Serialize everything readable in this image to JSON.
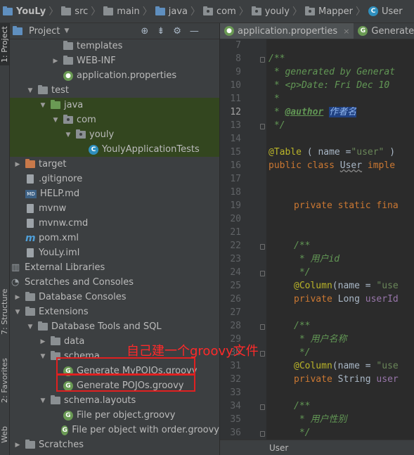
{
  "breadcrumb": [
    "YouLy",
    "src",
    "main",
    "java",
    "com",
    "youly",
    "Mapper",
    "User"
  ],
  "left_strip": {
    "project_tab": "1: Project",
    "structure_tab": "7: Structure",
    "favorites_tab": "2: Favorites",
    "web_tab": "Web"
  },
  "project_panel": {
    "title": "Project",
    "view_dropdown": "Project"
  },
  "tree": [
    {
      "label": "templates",
      "indent": 3,
      "icon": "folder",
      "arrow": "",
      "hl": ""
    },
    {
      "label": "WEB-INF",
      "indent": 3,
      "icon": "folder",
      "arrow": "right",
      "hl": ""
    },
    {
      "label": "application.properties",
      "indent": 3,
      "icon": "properties",
      "arrow": "",
      "hl": ""
    },
    {
      "label": "test",
      "indent": 1,
      "icon": "folder",
      "arrow": "down",
      "hl": ""
    },
    {
      "label": "java",
      "indent": 2,
      "icon": "folder-green",
      "arrow": "down",
      "hl": "green"
    },
    {
      "label": "com",
      "indent": 3,
      "icon": "package",
      "arrow": "down",
      "hl": "green"
    },
    {
      "label": "youly",
      "indent": 4,
      "icon": "package",
      "arrow": "down",
      "hl": "green"
    },
    {
      "label": "YoulyApplicationTests",
      "indent": 5,
      "icon": "class",
      "arrow": "",
      "hl": "green"
    },
    {
      "label": "target",
      "indent": 0,
      "icon": "folder-orange",
      "arrow": "right",
      "hl": ""
    },
    {
      "label": ".gitignore",
      "indent": 0,
      "icon": "file",
      "arrow": "",
      "hl": ""
    },
    {
      "label": "HELP.md",
      "indent": 0,
      "icon": "md",
      "arrow": "",
      "hl": ""
    },
    {
      "label": "mvnw",
      "indent": 0,
      "icon": "file",
      "arrow": "",
      "hl": ""
    },
    {
      "label": "mvnw.cmd",
      "indent": 0,
      "icon": "file",
      "arrow": "",
      "hl": ""
    },
    {
      "label": "pom.xml",
      "indent": 0,
      "icon": "maven",
      "arrow": "",
      "hl": ""
    },
    {
      "label": "YouLy.iml",
      "indent": 0,
      "icon": "file",
      "arrow": "",
      "hl": ""
    },
    {
      "label": "External Libraries",
      "indent": -1,
      "icon": "libs",
      "arrow": "",
      "hl": ""
    },
    {
      "label": "Scratches and Consoles",
      "indent": -1,
      "icon": "scratch",
      "arrow": "",
      "hl": ""
    },
    {
      "label": "Database Consoles",
      "indent": 0,
      "icon": "folder",
      "arrow": "right",
      "hl": ""
    },
    {
      "label": "Extensions",
      "indent": 0,
      "icon": "folder",
      "arrow": "down",
      "hl": ""
    },
    {
      "label": "Database Tools and SQL",
      "indent": 1,
      "icon": "folder",
      "arrow": "down",
      "hl": ""
    },
    {
      "label": "data",
      "indent": 2,
      "icon": "folder",
      "arrow": "right",
      "hl": ""
    },
    {
      "label": "schema",
      "indent": 2,
      "icon": "folder",
      "arrow": "down",
      "hl": ""
    },
    {
      "label": "Generate MyPOJOs.groovy",
      "indent": 3,
      "icon": "groovy",
      "arrow": "",
      "hl": ""
    },
    {
      "label": "Generate POJOs.groovy",
      "indent": 3,
      "icon": "groovy",
      "arrow": "",
      "hl": ""
    },
    {
      "label": "schema.layouts",
      "indent": 2,
      "icon": "folder",
      "arrow": "down",
      "hl": ""
    },
    {
      "label": "File per object.groovy",
      "indent": 3,
      "icon": "groovy",
      "arrow": "",
      "hl": ""
    },
    {
      "label": "File per object with order.groovy",
      "indent": 3,
      "icon": "groovy",
      "arrow": "",
      "hl": ""
    },
    {
      "label": "Scratches",
      "indent": 0,
      "icon": "folder",
      "arrow": "right",
      "hl": ""
    }
  ],
  "annotation_text": "自己建一个groovy文件",
  "editor": {
    "tabs": [
      {
        "label": "application.properties",
        "close": "×"
      },
      {
        "label": "Generate My",
        "close": ""
      }
    ],
    "line_numbers": [
      "7",
      "8",
      "9",
      "10",
      "11",
      "12",
      "13",
      "14",
      "15",
      "16",
      "17",
      "18",
      "19",
      "20",
      "21",
      "22",
      "23",
      "24",
      "25",
      "26",
      "27",
      "28",
      "29",
      "30",
      "31",
      "32",
      "33",
      "34",
      "35",
      "36"
    ],
    "current_line": "12",
    "code": {
      "l8": "/**",
      "l9_prefix": " * ",
      "l9_text": "generated by Generat",
      "l10_prefix": " * ",
      "l10_tag": "<p>",
      "l10_text": "Date: Fri Dec 10",
      "l11": " *",
      "l12_prefix": " * ",
      "l12_tag": "@author",
      "l12_text": "作者名",
      "l13": " */",
      "l15_ann": "@Table",
      "l15_a": " ( ",
      "l15_b": "name",
      "l15_c": " =",
      "l15_str": "\"user\"",
      "l15_d": " )",
      "l16_kw": "public class ",
      "l16_cls": "User",
      "l16_rest": " imple",
      "l19_kw": "private static fina",
      "l22": "/**",
      "l23_prefix": " * ",
      "l23_text": "用户id",
      "l24": " */",
      "l25_ann": "@Column",
      "l25_a": "(",
      "l25_b": "name",
      "l25_c": " = ",
      "l25_str": "\"use",
      "l26_kw": "private ",
      "l26_type": "Long ",
      "l26_var": "userId",
      "l28": "/**",
      "l29_prefix": " * ",
      "l29_text": "用户名称",
      "l30": " */",
      "l31_ann": "@Column",
      "l31_a": "(",
      "l31_b": "name",
      "l31_c": " = ",
      "l31_str": "\"use",
      "l32_kw": "private ",
      "l32_type": "String ",
      "l32_var": "user",
      "l34": "/**",
      "l35_prefix": " * ",
      "l35_text": "用户性别",
      "l36": " */"
    },
    "status_text": "User"
  },
  "colors": {
    "annotation_red": "#e02020",
    "highlight_green": "#33461f"
  }
}
